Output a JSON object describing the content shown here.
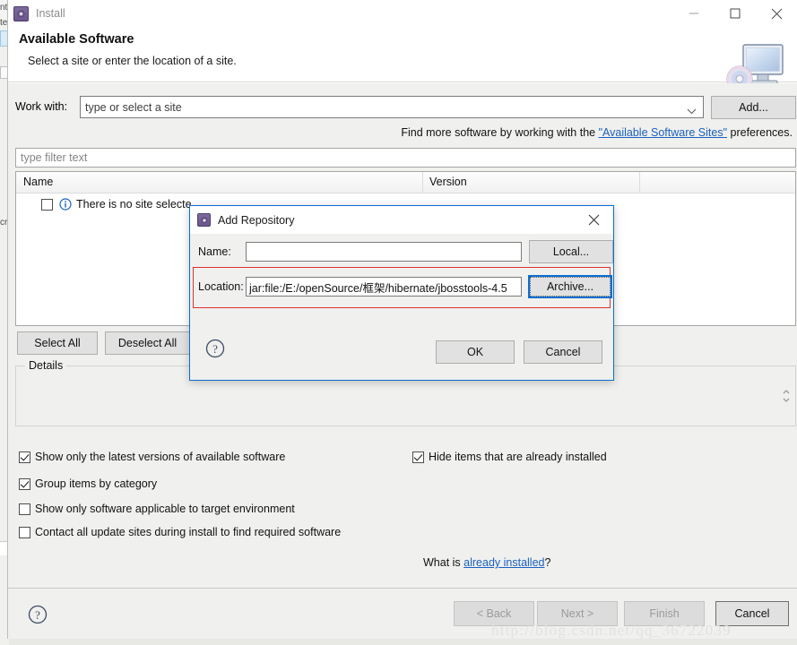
{
  "window": {
    "title": "Install",
    "title_icon": "gear-icon",
    "controls": {
      "minimize": "minimize-icon",
      "maximize": "maximize-icon",
      "close": "close-icon"
    }
  },
  "header": {
    "title": "Available Software",
    "subtitle": "Select a site or enter the location of a site.",
    "art_icon": "monitor-cd-icon"
  },
  "work_with": {
    "label": "Work with:",
    "value": "type or select a site",
    "placeholder": "type or select a site",
    "add_button": "Add..."
  },
  "find_more": {
    "prefix": "Find more software by working with the ",
    "link": "\"Available Software Sites\"",
    "suffix": " preferences."
  },
  "filter": {
    "placeholder": "type filter text",
    "value": ""
  },
  "table": {
    "columns": [
      "Name",
      "Version"
    ],
    "rows": [
      {
        "checked": false,
        "icon": "info-icon",
        "name": "There is no site selecte",
        "version": ""
      }
    ]
  },
  "buttons": {
    "select_all": "Select All",
    "deselect_all": "Deselect All"
  },
  "details": {
    "legend": "Details",
    "content": "",
    "spinner_icon": "spinner-updown-icon"
  },
  "options": {
    "left": [
      {
        "label": "Show only the latest versions of available software",
        "checked": true
      },
      {
        "label": "Group items by category",
        "checked": true
      },
      {
        "label": "Show only software applicable to target environment",
        "checked": false
      },
      {
        "label": "Contact all update sites during install to find required software",
        "checked": false
      }
    ],
    "right": [
      {
        "label": "Hide items that are already installed",
        "checked": true
      }
    ],
    "what_is": {
      "prefix": "What is ",
      "link": "already installed",
      "suffix": "?"
    }
  },
  "wizard_buttons": {
    "help_icon": "help-icon",
    "back": "< Back",
    "next": "Next >",
    "finish": "Finish",
    "cancel": "Cancel"
  },
  "add_repository": {
    "title": "Add Repository",
    "title_icon": "gear-icon",
    "close_icon": "close-icon",
    "name_label": "Name:",
    "name_value": "",
    "location_label": "Location:",
    "location_value": "jar:file:/E:/openSource/框架/hibernate/jbosstools-4.5",
    "local_button": "Local...",
    "archive_button": "Archive...",
    "help_icon": "help-icon",
    "ok_button": "OK",
    "cancel_button": "Cancel",
    "highlight_color": "#e03030",
    "focus_color": "#0a6ed1"
  },
  "watermark": "http://blog.csdn.net/qq_36722039",
  "background_fragments": {
    "f1": "nt",
    "f2": "te",
    "f3": "cr"
  }
}
